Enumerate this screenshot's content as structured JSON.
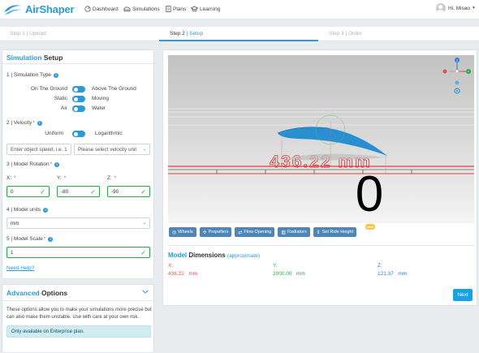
{
  "app": {
    "name": "AirShaper"
  },
  "nav": {
    "dashboard": "Dashboard",
    "simulations": "Simulations",
    "plans": "Plans",
    "learning": "Learning"
  },
  "user": {
    "greeting": "Hi, Misao"
  },
  "steps": {
    "step1": {
      "num": "Step 1",
      "sep": " | ",
      "label": "Upload"
    },
    "step2": {
      "num": "Step 2",
      "sep": " | ",
      "label": "Setup"
    },
    "step3": {
      "num": "Step 3",
      "sep": " | ",
      "label": "Order"
    }
  },
  "setup": {
    "title_highlight": "Simulation",
    "title_rest": " Setup",
    "simulation_type": {
      "label": "1 | Simulation Type",
      "rows": [
        {
          "left": "On The Ground",
          "right": "Above The Ground"
        },
        {
          "left": "Static",
          "right": "Moving"
        },
        {
          "left": "Air",
          "right": "Water"
        }
      ]
    },
    "velocity": {
      "label": "2 | Velocity",
      "left": "Uniform",
      "right": "Logarithmic",
      "speed_placeholder": "Enter object speed, i.e. 1",
      "unit_placeholder": "Please select velocity unit"
    },
    "rotation": {
      "label": "3 | Model Rotation",
      "x_label": "X:",
      "y_label": "Y:",
      "z_label": "Z:",
      "x": "0",
      "y": "-80",
      "z": "-90"
    },
    "units": {
      "label": "4 | Model units",
      "value": "mm"
    },
    "scale": {
      "label": "5 | Model Scale",
      "value": "1"
    },
    "help": "Need Help?"
  },
  "advanced": {
    "title_highlight": "Advanced",
    "title_rest": " Options",
    "description": "These options allow you to make your simulations more precise but can also make them unstable. Use with care at your own risk.",
    "notice": "Only available on Enterprise plan."
  },
  "viewer": {
    "ruler_text": "436.22 mm",
    "big_digit": "0",
    "buttons": {
      "wheels": "Wheels",
      "propellers": "Propellers",
      "flow_opening": "Flow Opening",
      "radiators": "Radiators",
      "ride_height": "Set Ride Height"
    },
    "badge": "New"
  },
  "dimensions": {
    "title_highlight": "Model",
    "title_rest": " Dimensions ",
    "approx": "(approximate)",
    "x_label": "X:",
    "x_value": "436.22",
    "x_unit": "mm",
    "y_label": "Y:",
    "y_value": "2000.00",
    "y_unit": "mm",
    "z_label": "Z:",
    "z_value": "121.37",
    "z_unit": "mm",
    "colors": {
      "x": "#d9534f",
      "y": "#28a745",
      "z": "#2b7bd6"
    }
  },
  "actions": {
    "next": "Next"
  }
}
